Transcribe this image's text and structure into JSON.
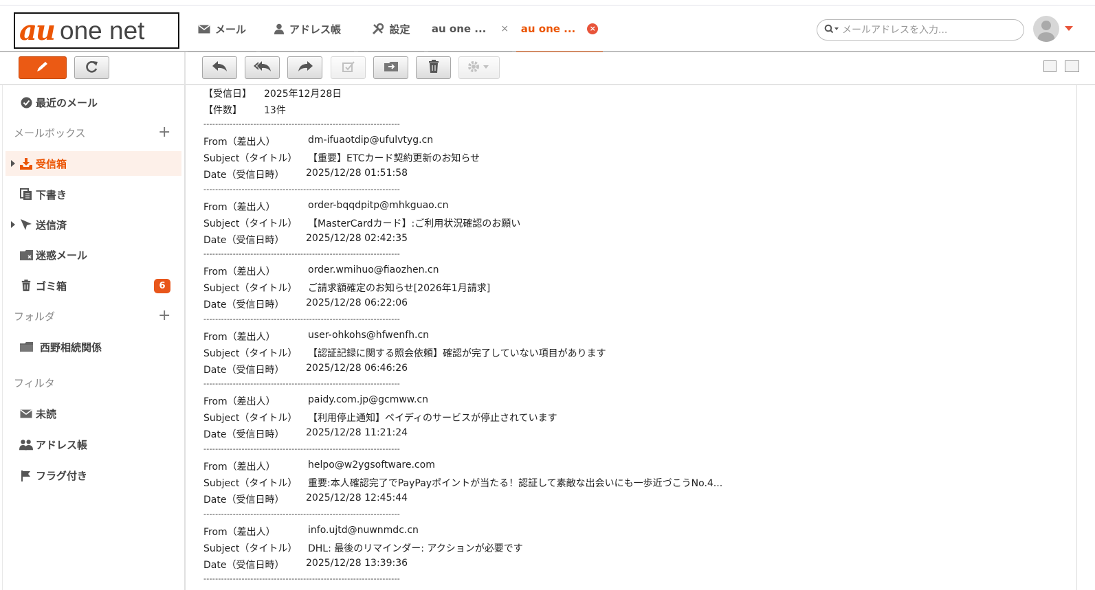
{
  "app": {
    "logo_au": "au",
    "logo_rest": "one net"
  },
  "tabs": [
    {
      "label": "メール"
    },
    {
      "label": "アドレス帳"
    },
    {
      "label": "設定"
    },
    {
      "label": "au one ...",
      "close": "×"
    },
    {
      "label": "au one ...",
      "close": "×"
    }
  ],
  "search": {
    "placeholder": "メールアドレスを入力..."
  },
  "sidebar": {
    "recent": "最近のメール",
    "mailbox_section": "メールボックス",
    "items": [
      {
        "label": "受信箱"
      },
      {
        "label": "下書き"
      },
      {
        "label": "送信済"
      },
      {
        "label": "迷惑メール"
      },
      {
        "label": "ゴミ箱",
        "badge": "6"
      }
    ],
    "folder_section": "フォルダ",
    "folders": [
      {
        "label": "西野相続関係"
      }
    ],
    "filter_section": "フィルタ",
    "filters": [
      {
        "label": "未読"
      },
      {
        "label": "アドレス帳"
      },
      {
        "label": "フラグ付き"
      }
    ],
    "plus": "+"
  },
  "message": {
    "received_label": "【受信日】",
    "received_value": "2025年12月28日",
    "count_label": "【件数】",
    "count_value": "13件",
    "separator": "-------------------------------------------------------------------",
    "from_label": "From（差出人）",
    "subject_label": "Subject（タイトル）",
    "date_label": "Date（受信日時）",
    "entries": [
      {
        "from": "dm-ifuaotdip@ufulvtyg.cn",
        "subject": "【重要】ETCカード契約更新のお知らせ",
        "date": "2025/12/28 01:51:58"
      },
      {
        "from": "order-bqqdpitp@mhkguao.cn",
        "subject": "【MasterCardカード】:ご利用状況確認のお願い",
        "date": "2025/12/28 02:42:35"
      },
      {
        "from": "order.wmihuo@fiaozhen.cn",
        "subject": "ご請求額確定のお知らせ[2026年1月請求]",
        "date": "2025/12/28 06:22:06"
      },
      {
        "from": "user-ohkohs@hfwenfh.cn",
        "subject": "【認証記録に関する照会依頼】確認が完了していない項目があります",
        "date": "2025/12/28 06:46:26"
      },
      {
        "from": "paidy.com.jp@gcmww.cn",
        "subject": "【利用停止通知】ペイディのサービスが停止されています",
        "date": "2025/12/28 11:21:24"
      },
      {
        "from": "helpo@w2ygsoftware.com",
        "subject": "重要:本人確認完了でPayPayポイントが当たる！認証して素敵な出会いにも一歩近づこうNo.4...",
        "date": "2025/12/28 12:45:44"
      },
      {
        "from": "info.ujtd@nuwnmdc.cn",
        "subject": "DHL: 最後のリマインダー: アクションが必要です",
        "date": "2025/12/28 13:39:36"
      }
    ]
  },
  "colors": {
    "accent": "#eb5505",
    "badge": "#e8561b",
    "selected_bg": "#fdf0e9"
  },
  "icons": [
    "mail-icon",
    "person-icon",
    "tools-icon",
    "search-icon",
    "pencil-icon",
    "refresh-icon",
    "reply-icon",
    "reply-all-icon",
    "forward-icon",
    "checkbox-edit-icon",
    "move-folder-icon",
    "trash-icon",
    "gear-icon"
  ]
}
